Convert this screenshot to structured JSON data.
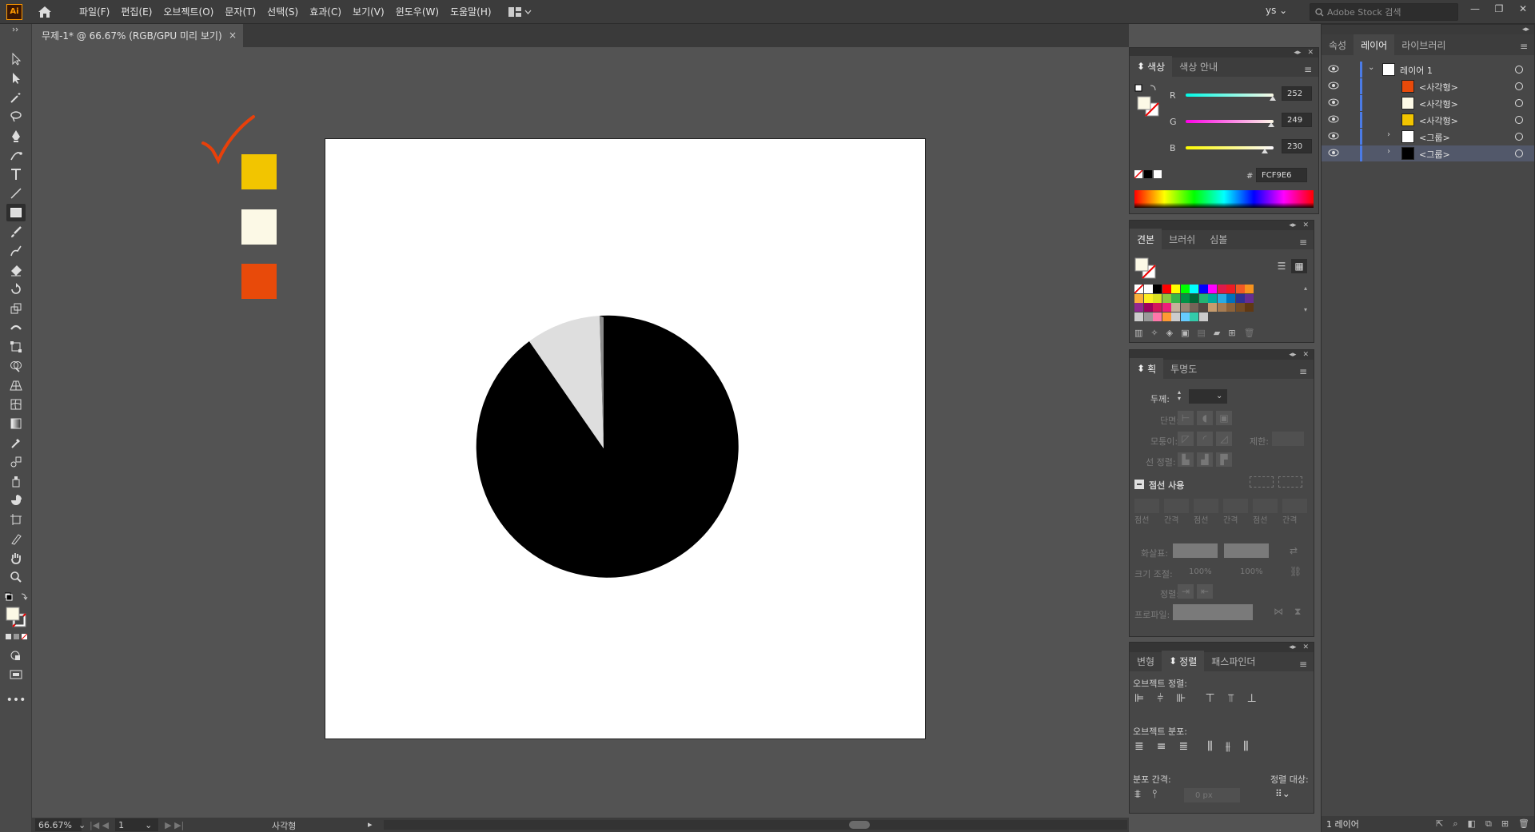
{
  "app": {
    "logo": "Ai"
  },
  "menu": [
    "파일(F)",
    "편집(E)",
    "오브젝트(O)",
    "문자(T)",
    "선택(S)",
    "효과(C)",
    "보기(V)",
    "윈도우(W)",
    "도움말(H)"
  ],
  "user": "ys",
  "search": {
    "placeholder": "Adobe Stock 검색"
  },
  "document": {
    "tab_label": "무제-1* @ 66.67% (RGB/GPU 미리 보기)",
    "close": "×"
  },
  "canvas": {
    "swatches": [
      "#f2c500",
      "#fcf9e6",
      "#e84a0a"
    ],
    "pie_colors": {
      "main": "#000000",
      "light": "#dedede",
      "thin": "#8a8a8a"
    }
  },
  "status": {
    "zoom": "66.67%",
    "page": "1",
    "selection": "사각형"
  },
  "color_panel": {
    "tabs": [
      "색상",
      "색상 안내"
    ],
    "r_label": "R",
    "g_label": "G",
    "b_label": "B",
    "r": "252",
    "g": "249",
    "b": "230",
    "r_level": 0.988,
    "g_level": 0.976,
    "b_level": 0.902,
    "hex_prefix": "#",
    "hex": "FCF9E6"
  },
  "swatch_panel": {
    "tabs": [
      "견본",
      "브러쉬",
      "심볼"
    ],
    "rows": [
      [
        "none",
        "#ffffff",
        "#000000",
        "#ff0000",
        "#ffff00",
        "#00ff00",
        "#00ffff",
        "#0000ff",
        "#ff00ff",
        "#e0194a",
        "#ed1c24",
        "#f15a24",
        "#f7931e"
      ],
      [
        "#fbb03b",
        "#fcee21",
        "#d9e021",
        "#8cc63f",
        "#39b54a",
        "#009245",
        "#006837",
        "#22b573",
        "#00a99d",
        "#29abe2",
        "#0071bc",
        "#2e3192",
        "#662d91"
      ],
      [
        "#93278f",
        "#9e005d",
        "#d4145a",
        "#ed1e79",
        "#c7b299",
        "#998675",
        "#736357",
        "#534741",
        "#c69c6d",
        "#a67c52",
        "#8c6239",
        "#754c24",
        "#603813"
      ],
      [
        "#ccc",
        "#999",
        "#f7a",
        "#f93",
        "#ccc",
        "#6cf",
        "#3ca",
        "#ccc"
      ]
    ]
  },
  "stroke_panel": {
    "tabs": [
      "획",
      "투명도"
    ],
    "weight_label": "두께:",
    "cap_label": "단면:",
    "corner_label": "모퉁이:",
    "limit_label": "제한:",
    "align_label": "선 정렬:",
    "dashed_label": "점선 사용",
    "dash_labels": [
      "점선",
      "간격",
      "점선",
      "간격",
      "점선",
      "간격"
    ],
    "arrow_label": "화살표:",
    "scale_label": "크기 조절:",
    "scale_values": [
      "100%",
      "100%"
    ],
    "align2_label": "정렬:",
    "profile_label": "프로파일:"
  },
  "align_panel": {
    "tabs": [
      "변형",
      "정렬",
      "패스파인더"
    ],
    "object_align": "오브젝트 정렬:",
    "object_distribute": "오브젝트 분포:",
    "distribute_spacing": "분포 간격:",
    "align_to": "정렬 대상:",
    "spacing_value": "0 px"
  },
  "layers_panel": {
    "tabs": [
      "속성",
      "레이어",
      "라이브러리"
    ],
    "rows": [
      {
        "name": "레이어 1",
        "thumb": "#ffffff",
        "expanded": true
      },
      {
        "name": "<사각형>",
        "thumb": "#e84a0a"
      },
      {
        "name": "<사각형>",
        "thumb": "#fcf9e6"
      },
      {
        "name": "<사각형>",
        "thumb": "#f2c500"
      },
      {
        "name": "<그룹>",
        "thumb": "#ffffff"
      },
      {
        "name": "<그룹>",
        "thumb": "#000000"
      }
    ],
    "footer": "1 레이어"
  }
}
